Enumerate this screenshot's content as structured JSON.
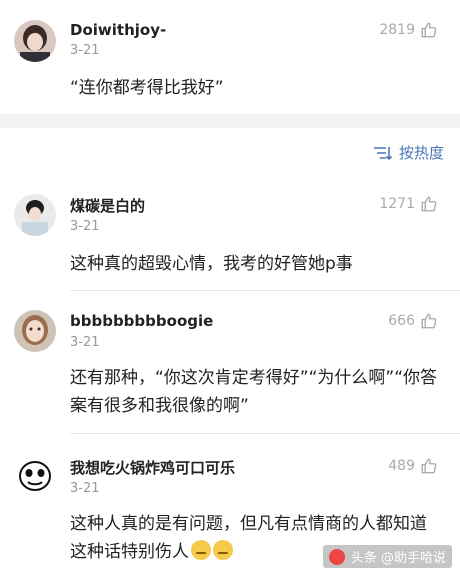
{
  "comments": [
    {
      "username": "Doiwithjoy-",
      "date": "3-21",
      "likes": "2819",
      "text": "“连你都考得比我好”"
    },
    {
      "username": "煤碳是白的",
      "date": "3-21",
      "likes": "1271",
      "text": "这种真的超毁心情，我考的好管她p事"
    },
    {
      "username": "bbbbbbbbboogie",
      "date": "3-21",
      "likes": "666",
      "text": "还有那种，“你这次肯定考得好”“为什么啊”“你答案有很多和我很像的啊”"
    },
    {
      "username": "我想吃火锅炸鸡可口可乐",
      "date": "3-21",
      "likes": "489",
      "text": "这种人真的是有问题，但凡有点情商的人都知道这种话特别伤人"
    }
  ],
  "sort": {
    "label": "按热度",
    "icon": "sort-icon"
  },
  "icons": {
    "like": "thumbs-up-icon"
  },
  "watermark": "头条 @助手哈说",
  "colors": {
    "accent": "#4a77b8",
    "muted": "#999999",
    "likes": "#aaaaaa"
  }
}
